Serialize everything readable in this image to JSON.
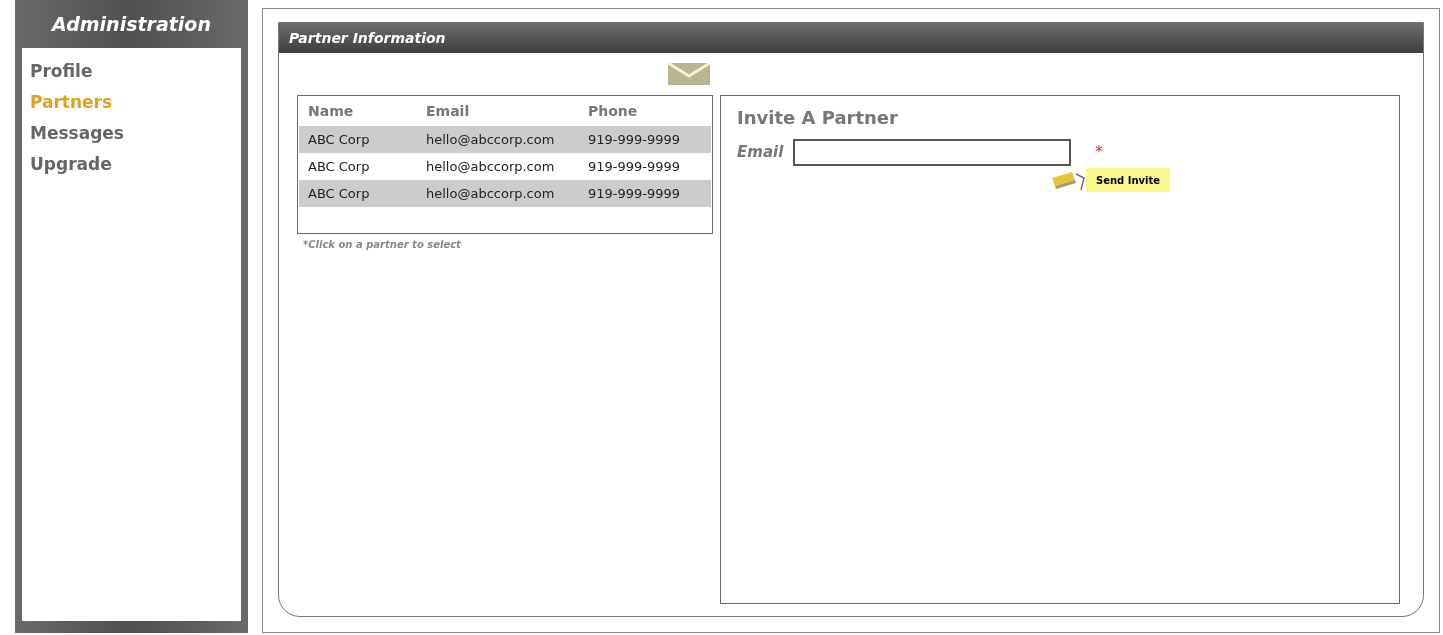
{
  "sidebar": {
    "title": "Administration",
    "items": [
      {
        "label": "Profile",
        "selected": false
      },
      {
        "label": "Partners",
        "selected": true
      },
      {
        "label": "Messages",
        "selected": false
      },
      {
        "label": "Upgrade",
        "selected": false
      }
    ]
  },
  "panel": {
    "title": "Partner Information",
    "table": {
      "columns": [
        "Name",
        "Email",
        "Phone"
      ],
      "rows": [
        [
          "ABC Corp",
          "hello@abccorp.com",
          "919-999-9999"
        ],
        [
          "ABC Corp",
          "hello@abccorp.com",
          "919-999-9999"
        ],
        [
          "ABC Corp",
          "hello@abccorp.com",
          "919-999-9999"
        ]
      ]
    },
    "hint": "*Click on a partner to select",
    "invite": {
      "title": "Invite A Partner",
      "email_label": "Email",
      "required_mark": "*",
      "button": "Send Invite"
    }
  }
}
